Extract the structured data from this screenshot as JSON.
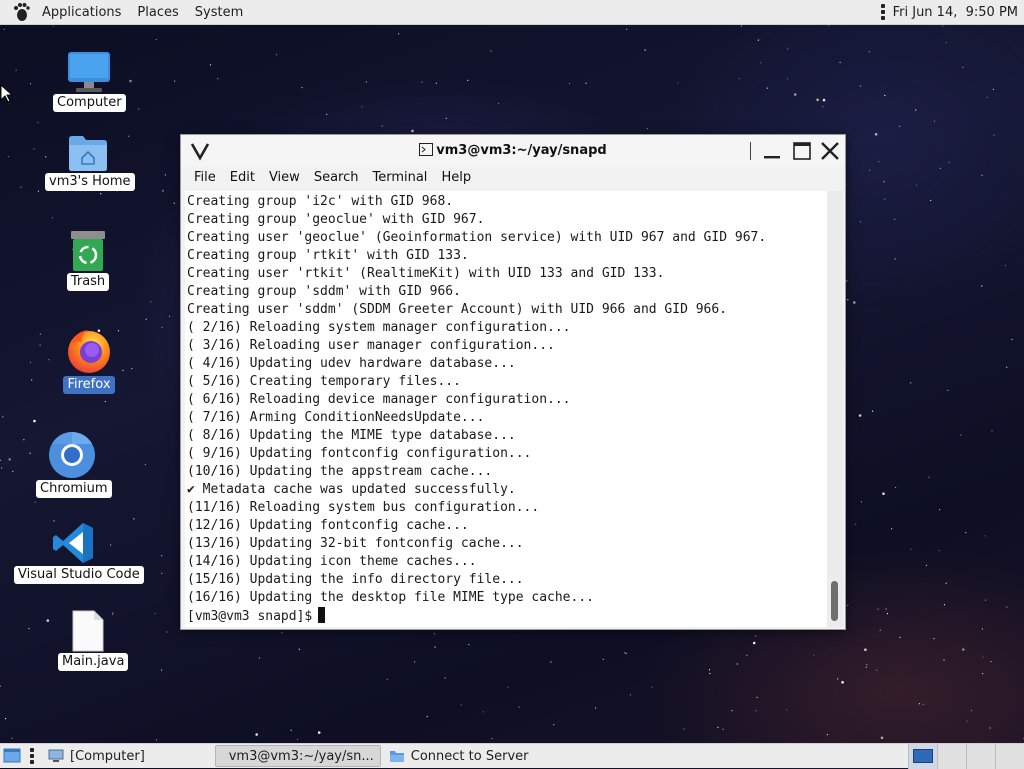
{
  "top_panel": {
    "menus": [
      "Applications",
      "Places",
      "System"
    ],
    "clock": "Fri Jun 14,  9:50 PM"
  },
  "desktop_icons": [
    {
      "label": "Computer",
      "icon": "computer-icon"
    },
    {
      "label": "vm3's Home",
      "icon": "home-folder-icon"
    },
    {
      "label": "Trash",
      "icon": "trash-icon"
    },
    {
      "label": "Firefox",
      "icon": "firefox-icon",
      "selected": true
    },
    {
      "label": "Chromium",
      "icon": "chromium-icon"
    },
    {
      "label": "Visual Studio Code",
      "icon": "vscode-icon"
    },
    {
      "label": "Main.java",
      "icon": "file-icon"
    }
  ],
  "terminal": {
    "title": "vm3@vm3:~/yay/snapd",
    "menus": [
      "File",
      "Edit",
      "View",
      "Search",
      "Terminal",
      "Help"
    ],
    "lines": [
      "Creating group 'i2c' with GID 968.",
      "Creating group 'geoclue' with GID 967.",
      "Creating user 'geoclue' (Geoinformation service) with UID 967 and GID 967.",
      "Creating group 'rtkit' with GID 133.",
      "Creating user 'rtkit' (RealtimeKit) with UID 133 and GID 133.",
      "Creating group 'sddm' with GID 966.",
      "Creating user 'sddm' (SDDM Greeter Account) with UID 966 and GID 966.",
      "( 2/16) Reloading system manager configuration...",
      "( 3/16) Reloading user manager configuration...",
      "( 4/16) Updating udev hardware database...",
      "( 5/16) Creating temporary files...",
      "( 6/16) Reloading device manager configuration...",
      "( 7/16) Arming ConditionNeedsUpdate...",
      "( 8/16) Updating the MIME type database...",
      "( 9/16) Updating fontconfig configuration...",
      "(10/16) Updating the appstream cache...",
      "✔ Metadata cache was updated successfully.",
      "(11/16) Reloading system bus configuration...",
      "(12/16) Updating fontconfig cache...",
      "(13/16) Updating 32-bit fontconfig cache...",
      "(14/16) Updating icon theme caches...",
      "(15/16) Updating the info directory file...",
      "(16/16) Updating the desktop file MIME type cache..."
    ],
    "prompt": "[vm3@vm3 snapd]$"
  },
  "bottom_panel": {
    "tasks": [
      {
        "label": "[Computer]",
        "icon": "computer-icon",
        "active": false
      },
      {
        "label": "vm3@vm3:~/yay/sn...",
        "icon": "terminal-icon",
        "active": true
      },
      {
        "label": "Connect to Server",
        "icon": "folder-icon",
        "active": false
      }
    ],
    "workspaces": 4,
    "current_workspace": 1
  },
  "colors": {
    "selection": "#3f72c2",
    "panel": "#ececec",
    "terminal_bg": "#ffffff"
  }
}
